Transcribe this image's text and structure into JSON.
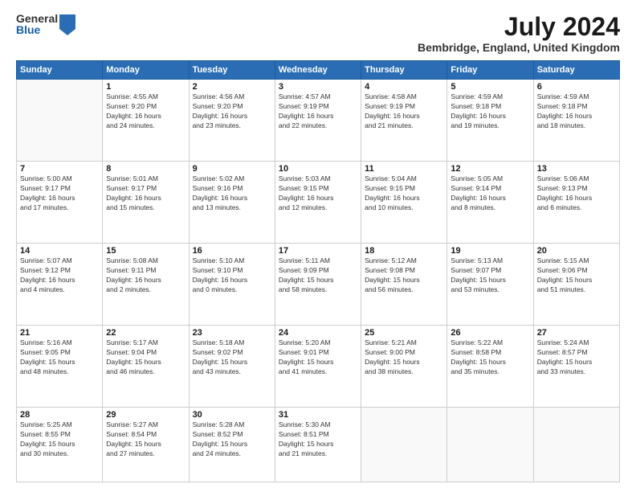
{
  "logo": {
    "general": "General",
    "blue": "Blue"
  },
  "title": {
    "month_year": "July 2024",
    "location": "Bembridge, England, United Kingdom"
  },
  "headers": [
    "Sunday",
    "Monday",
    "Tuesday",
    "Wednesday",
    "Thursday",
    "Friday",
    "Saturday"
  ],
  "weeks": [
    [
      {
        "day": "",
        "info": ""
      },
      {
        "day": "1",
        "info": "Sunrise: 4:55 AM\nSunset: 9:20 PM\nDaylight: 16 hours\nand 24 minutes."
      },
      {
        "day": "2",
        "info": "Sunrise: 4:56 AM\nSunset: 9:20 PM\nDaylight: 16 hours\nand 23 minutes."
      },
      {
        "day": "3",
        "info": "Sunrise: 4:57 AM\nSunset: 9:19 PM\nDaylight: 16 hours\nand 22 minutes."
      },
      {
        "day": "4",
        "info": "Sunrise: 4:58 AM\nSunset: 9:19 PM\nDaylight: 16 hours\nand 21 minutes."
      },
      {
        "day": "5",
        "info": "Sunrise: 4:59 AM\nSunset: 9:18 PM\nDaylight: 16 hours\nand 19 minutes."
      },
      {
        "day": "6",
        "info": "Sunrise: 4:59 AM\nSunset: 9:18 PM\nDaylight: 16 hours\nand 18 minutes."
      }
    ],
    [
      {
        "day": "7",
        "info": "Sunrise: 5:00 AM\nSunset: 9:17 PM\nDaylight: 16 hours\nand 17 minutes."
      },
      {
        "day": "8",
        "info": "Sunrise: 5:01 AM\nSunset: 9:17 PM\nDaylight: 16 hours\nand 15 minutes."
      },
      {
        "day": "9",
        "info": "Sunrise: 5:02 AM\nSunset: 9:16 PM\nDaylight: 16 hours\nand 13 minutes."
      },
      {
        "day": "10",
        "info": "Sunrise: 5:03 AM\nSunset: 9:15 PM\nDaylight: 16 hours\nand 12 minutes."
      },
      {
        "day": "11",
        "info": "Sunrise: 5:04 AM\nSunset: 9:15 PM\nDaylight: 16 hours\nand 10 minutes."
      },
      {
        "day": "12",
        "info": "Sunrise: 5:05 AM\nSunset: 9:14 PM\nDaylight: 16 hours\nand 8 minutes."
      },
      {
        "day": "13",
        "info": "Sunrise: 5:06 AM\nSunset: 9:13 PM\nDaylight: 16 hours\nand 6 minutes."
      }
    ],
    [
      {
        "day": "14",
        "info": "Sunrise: 5:07 AM\nSunset: 9:12 PM\nDaylight: 16 hours\nand 4 minutes."
      },
      {
        "day": "15",
        "info": "Sunrise: 5:08 AM\nSunset: 9:11 PM\nDaylight: 16 hours\nand 2 minutes."
      },
      {
        "day": "16",
        "info": "Sunrise: 5:10 AM\nSunset: 9:10 PM\nDaylight: 16 hours\nand 0 minutes."
      },
      {
        "day": "17",
        "info": "Sunrise: 5:11 AM\nSunset: 9:09 PM\nDaylight: 15 hours\nand 58 minutes."
      },
      {
        "day": "18",
        "info": "Sunrise: 5:12 AM\nSunset: 9:08 PM\nDaylight: 15 hours\nand 56 minutes."
      },
      {
        "day": "19",
        "info": "Sunrise: 5:13 AM\nSunset: 9:07 PM\nDaylight: 15 hours\nand 53 minutes."
      },
      {
        "day": "20",
        "info": "Sunrise: 5:15 AM\nSunset: 9:06 PM\nDaylight: 15 hours\nand 51 minutes."
      }
    ],
    [
      {
        "day": "21",
        "info": "Sunrise: 5:16 AM\nSunset: 9:05 PM\nDaylight: 15 hours\nand 48 minutes."
      },
      {
        "day": "22",
        "info": "Sunrise: 5:17 AM\nSunset: 9:04 PM\nDaylight: 15 hours\nand 46 minutes."
      },
      {
        "day": "23",
        "info": "Sunrise: 5:18 AM\nSunset: 9:02 PM\nDaylight: 15 hours\nand 43 minutes."
      },
      {
        "day": "24",
        "info": "Sunrise: 5:20 AM\nSunset: 9:01 PM\nDaylight: 15 hours\nand 41 minutes."
      },
      {
        "day": "25",
        "info": "Sunrise: 5:21 AM\nSunset: 9:00 PM\nDaylight: 15 hours\nand 38 minutes."
      },
      {
        "day": "26",
        "info": "Sunrise: 5:22 AM\nSunset: 8:58 PM\nDaylight: 15 hours\nand 35 minutes."
      },
      {
        "day": "27",
        "info": "Sunrise: 5:24 AM\nSunset: 8:57 PM\nDaylight: 15 hours\nand 33 minutes."
      }
    ],
    [
      {
        "day": "28",
        "info": "Sunrise: 5:25 AM\nSunset: 8:55 PM\nDaylight: 15 hours\nand 30 minutes."
      },
      {
        "day": "29",
        "info": "Sunrise: 5:27 AM\nSunset: 8:54 PM\nDaylight: 15 hours\nand 27 minutes."
      },
      {
        "day": "30",
        "info": "Sunrise: 5:28 AM\nSunset: 8:52 PM\nDaylight: 15 hours\nand 24 minutes."
      },
      {
        "day": "31",
        "info": "Sunrise: 5:30 AM\nSunset: 8:51 PM\nDaylight: 15 hours\nand 21 minutes."
      },
      {
        "day": "",
        "info": ""
      },
      {
        "day": "",
        "info": ""
      },
      {
        "day": "",
        "info": ""
      }
    ]
  ]
}
